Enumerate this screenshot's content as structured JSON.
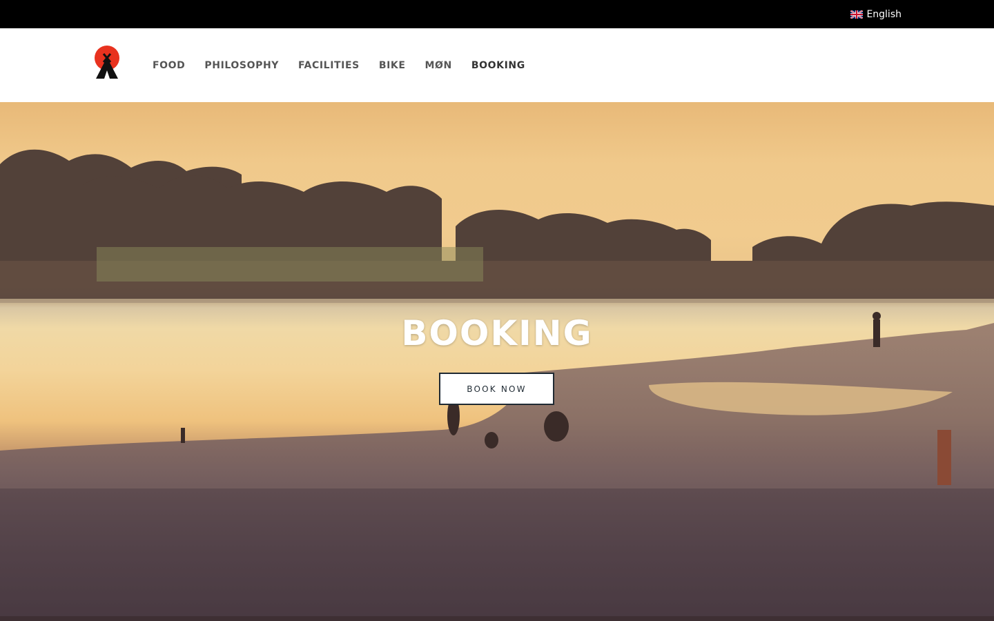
{
  "topbar": {
    "language": {
      "label": "English",
      "flag_icon": "uk-flag-icon"
    }
  },
  "navbar": {
    "logo_icon": "tipi-tent-logo",
    "items": [
      {
        "label": "FOOD"
      },
      {
        "label": "PHILOSOPHY"
      },
      {
        "label": "FACILITIES"
      },
      {
        "label": "BIKE"
      },
      {
        "label": "MØN"
      },
      {
        "label": "BOOKING",
        "active": true
      }
    ]
  },
  "hero": {
    "title": "BOOKING",
    "cta_label": "BOOK NOW"
  },
  "colors": {
    "topbar_bg": "#000000",
    "logo_red": "#e8321f",
    "button_border": "#1f2a33"
  }
}
